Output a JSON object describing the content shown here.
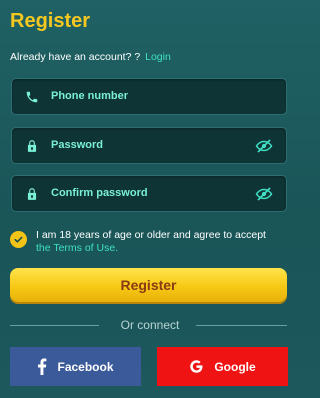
{
  "header": {
    "title": "Register",
    "login_prompt": "Already have an account? ?",
    "login_link": "Login"
  },
  "form": {
    "phone_placeholder": "Phone number",
    "password_placeholder": "Password",
    "confirm_password_placeholder": "Confirm password",
    "agree_text": "I am 18 years of age or older and agree to accept",
    "terms_link": "the Terms of Use.",
    "agree_checked": true,
    "register_label": "Register"
  },
  "social": {
    "divider_label": "Or connect",
    "facebook_label": "Facebook",
    "google_label": "Google"
  },
  "icons": {
    "phone": "phone-icon",
    "lock": "lock-icon",
    "eye_off": "eye-off-icon",
    "check": "check-icon",
    "facebook": "facebook-icon",
    "google": "google-icon"
  },
  "colors": {
    "accent_yellow": "#f5c81f",
    "accent_teal": "#3fe0c4",
    "background": "#1c5a5e",
    "facebook_blue": "#3b5a9a",
    "google_red": "#ef1313"
  }
}
